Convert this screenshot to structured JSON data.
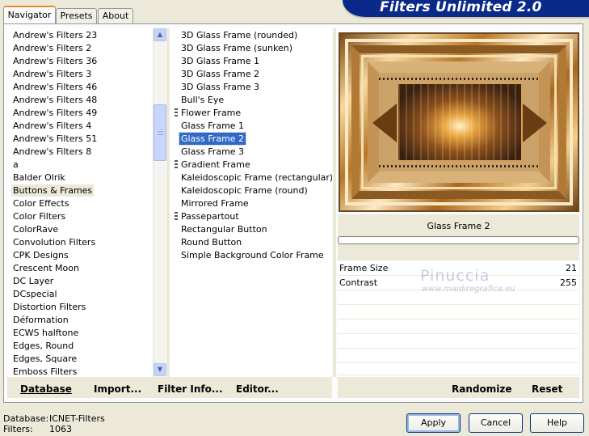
{
  "app": {
    "title": "Filters Unlimited 2.0"
  },
  "tabs": [
    {
      "label": "Navigator",
      "active": true
    },
    {
      "label": "Presets",
      "active": false
    },
    {
      "label": "About",
      "active": false
    }
  ],
  "categories": {
    "items": [
      "Andrew's Filters 23",
      "Andrew's Filters 2",
      "Andrew's Filters 36",
      "Andrew's Filters 3",
      "Andrew's Filters 46",
      "Andrew's Filters 48",
      "Andrew's Filters 49",
      "Andrew's Filters 4",
      "Andrew's Filters 51",
      "Andrew's Filters 8",
      "a",
      "Balder Olrik",
      "Buttons & Frames",
      "Color Effects",
      "Color Filters",
      "ColorRave",
      "Convolution Filters",
      "CPK Designs",
      "Crescent Moon",
      "DC Layer",
      "DCspecial",
      "Distortion Filters",
      "Déformation",
      "ECWS halftone",
      "Edges, Round",
      "Edges, Square",
      "Emboss Filters"
    ],
    "selected": "Buttons & Frames"
  },
  "filters": {
    "items": [
      {
        "label": "3D Glass Frame (rounded)",
        "group": false
      },
      {
        "label": "3D Glass Frame (sunken)",
        "group": false
      },
      {
        "label": "3D Glass Frame 1",
        "group": false
      },
      {
        "label": "3D Glass Frame 2",
        "group": false
      },
      {
        "label": "3D Glass Frame 3",
        "group": false
      },
      {
        "label": "Bull's Eye",
        "group": false
      },
      {
        "label": "Flower Frame",
        "group": true
      },
      {
        "label": "Glass Frame 1",
        "group": false
      },
      {
        "label": "Glass Frame 2",
        "group": false
      },
      {
        "label": "Glass Frame 3",
        "group": false
      },
      {
        "label": "Gradient Frame",
        "group": true
      },
      {
        "label": "Kaleidoscopic Frame (rectangular)",
        "group": false
      },
      {
        "label": "Kaleidoscopic Frame (round)",
        "group": false
      },
      {
        "label": "Mirrored Frame",
        "group": false
      },
      {
        "label": "Passepartout",
        "group": true
      },
      {
        "label": "Rectangular Button",
        "group": false
      },
      {
        "label": "Round Button",
        "group": false
      },
      {
        "label": "Simple Background Color Frame",
        "group": false
      }
    ],
    "selected": "Glass Frame 2"
  },
  "preview": {
    "filter_name": "Glass Frame 2",
    "sliders": [
      {
        "label": "Frame Size",
        "value": "21"
      },
      {
        "label": "Contrast",
        "value": "255"
      }
    ],
    "watermark": "Pinuccia",
    "watermark_sub": "www.maidiregrafica.eu"
  },
  "toolbar": {
    "database": "Database",
    "import": "Import...",
    "filter_info": "Filter Info...",
    "editor": "Editor...",
    "randomize": "Randomize",
    "reset": "Reset"
  },
  "status": {
    "database_label": "Database:",
    "database_value": "ICNET-Filters",
    "filters_label": "Filters:",
    "filters_value": "1063"
  },
  "buttons": {
    "apply": "Apply",
    "cancel": "Cancel",
    "help": "Help"
  },
  "colors": {
    "banner": "#0a2a8a",
    "selection": "#316ac5",
    "face": "#ece9d8"
  }
}
